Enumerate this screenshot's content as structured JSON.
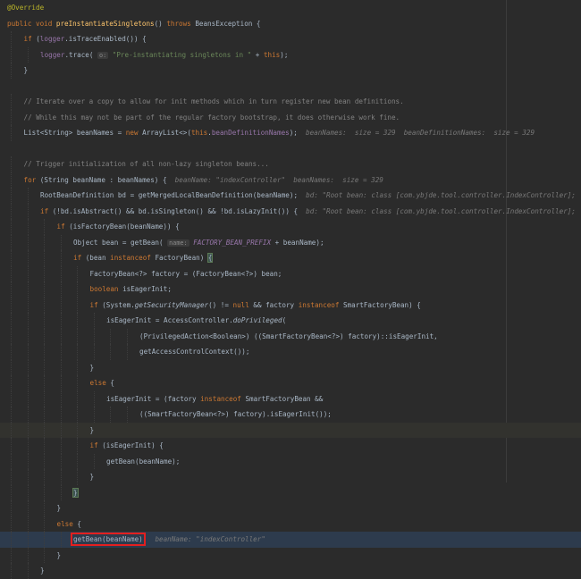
{
  "editor": {
    "lines": [
      {
        "indent": 0,
        "segs": [
          {
            "t": "@Override",
            "c": "ann"
          }
        ]
      },
      {
        "indent": 0,
        "segs": [
          {
            "t": "public void ",
            "c": "kw"
          },
          {
            "t": "preInstantiateSingletons",
            "c": "fn"
          },
          {
            "t": "() "
          },
          {
            "t": "throws ",
            "c": "kw"
          },
          {
            "t": "BeansException {"
          }
        ]
      },
      {
        "indent": 1,
        "segs": [
          {
            "t": "if ",
            "c": "kw"
          },
          {
            "t": "("
          },
          {
            "t": "logger",
            "c": "fld"
          },
          {
            "t": ".isTraceEnabled()) {"
          }
        ]
      },
      {
        "indent": 2,
        "segs": [
          {
            "t": "logger",
            "c": "fld"
          },
          {
            "t": ".trace( "
          },
          {
            "t": "o:",
            "c": "phint"
          },
          {
            "t": " "
          },
          {
            "t": "\"Pre-instantiating singletons in \"",
            "c": "str"
          },
          {
            "t": " + "
          },
          {
            "t": "this",
            "c": "kw"
          },
          {
            "t": ");"
          }
        ]
      },
      {
        "indent": 1,
        "segs": [
          {
            "t": "}"
          }
        ]
      },
      {
        "indent": 0,
        "segs": []
      },
      {
        "indent": 1,
        "segs": [
          {
            "t": "// Iterate over a copy to allow for init methods which in turn register new bean definitions.",
            "c": "cmt"
          }
        ]
      },
      {
        "indent": 1,
        "segs": [
          {
            "t": "// While this may not be part of the regular factory bootstrap, it does otherwise work fine.",
            "c": "cmt"
          }
        ]
      },
      {
        "indent": 1,
        "segs": [
          {
            "t": "List<String> beanNames = "
          },
          {
            "t": "new ",
            "c": "kw"
          },
          {
            "t": "ArrayList<>("
          },
          {
            "t": "this",
            "c": "kw"
          },
          {
            "t": "."
          },
          {
            "t": "beanDefinitionNames",
            "c": "fld"
          },
          {
            "t": ");  "
          },
          {
            "t": "beanNames:  size = 329  beanDefinitionNames:  size = 329",
            "c": "hint"
          }
        ]
      },
      {
        "indent": 0,
        "segs": []
      },
      {
        "indent": 1,
        "segs": [
          {
            "t": "// Trigger initialization of all non-lazy singleton beans...",
            "c": "cmt"
          }
        ]
      },
      {
        "indent": 1,
        "segs": [
          {
            "t": "for ",
            "c": "kw"
          },
          {
            "t": "(String beanName : beanNames) {  "
          },
          {
            "t": "beanName: \"indexController\"  beanNames:  size = 329",
            "c": "hint"
          }
        ]
      },
      {
        "indent": 2,
        "segs": [
          {
            "t": "RootBeanDefinition bd = getMergedLocalBeanDefinition(beanName);  "
          },
          {
            "t": "bd: \"Root bean: class [com.ybjde.tool.controller.IndexController];",
            "c": "hint"
          }
        ]
      },
      {
        "indent": 2,
        "segs": [
          {
            "t": "if ",
            "c": "kw"
          },
          {
            "t": "(!bd.isAbstract() && bd.isSingleton() && !bd.isLazyInit()) {  "
          },
          {
            "t": "bd: \"Root bean: class [com.ybjde.tool.controller.IndexController];",
            "c": "hint"
          }
        ]
      },
      {
        "indent": 3,
        "segs": [
          {
            "t": "if ",
            "c": "kw"
          },
          {
            "t": "(isFactoryBean(beanName)) {"
          }
        ]
      },
      {
        "indent": 4,
        "segs": [
          {
            "t": "Object bean = getBean( "
          },
          {
            "t": "name:",
            "c": "phint"
          },
          {
            "t": " "
          },
          {
            "t": "FACTORY_BEAN_PREFIX",
            "c": "sfld"
          },
          {
            "t": " + beanName);"
          }
        ]
      },
      {
        "indent": 4,
        "segs": [
          {
            "t": "if ",
            "c": "kw"
          },
          {
            "t": "(bean "
          },
          {
            "t": "instanceof ",
            "c": "kw"
          },
          {
            "t": "FactoryBean) "
          },
          {
            "t": "{",
            "c": "brace-match"
          }
        ]
      },
      {
        "indent": 5,
        "segs": [
          {
            "t": "FactoryBean<?> factory = (FactoryBean<?>) bean;"
          }
        ]
      },
      {
        "indent": 5,
        "segs": [
          {
            "t": "boolean ",
            "c": "kw"
          },
          {
            "t": "isEagerInit;"
          }
        ]
      },
      {
        "indent": 5,
        "segs": [
          {
            "t": "if ",
            "c": "kw"
          },
          {
            "t": "(System."
          },
          {
            "t": "getSecurityManager",
            "c": "it"
          },
          {
            "t": "() != "
          },
          {
            "t": "null ",
            "c": "kw"
          },
          {
            "t": "&& factory "
          },
          {
            "t": "instanceof ",
            "c": "kw"
          },
          {
            "t": "SmartFactoryBean) {"
          }
        ]
      },
      {
        "indent": 6,
        "segs": [
          {
            "t": "isEagerInit = AccessController."
          },
          {
            "t": "doPrivileged",
            "c": "it"
          },
          {
            "t": "("
          }
        ]
      },
      {
        "indent": 8,
        "segs": [
          {
            "t": "(PrivilegedAction<Boolean>) ((SmartFactoryBean<?>) factory)::isEagerInit,"
          }
        ]
      },
      {
        "indent": 8,
        "segs": [
          {
            "t": "getAccessControlContext());"
          }
        ]
      },
      {
        "indent": 5,
        "segs": [
          {
            "t": "}"
          }
        ]
      },
      {
        "indent": 5,
        "segs": [
          {
            "t": "else ",
            "c": "kw"
          },
          {
            "t": "{"
          }
        ]
      },
      {
        "indent": 6,
        "segs": [
          {
            "t": "isEagerInit = (factory "
          },
          {
            "t": "instanceof ",
            "c": "kw"
          },
          {
            "t": "SmartFactoryBean &&"
          }
        ]
      },
      {
        "indent": 8,
        "segs": [
          {
            "t": "((SmartFactoryBean<?>) factory).isEagerInit());"
          }
        ]
      },
      {
        "indent": 5,
        "segs": [
          {
            "t": "}"
          }
        ]
      },
      {
        "indent": 5,
        "segs": [
          {
            "t": "if ",
            "c": "kw"
          },
          {
            "t": "(isEagerInit) {"
          }
        ]
      },
      {
        "indent": 6,
        "segs": [
          {
            "t": "getBean(beanName);"
          }
        ]
      },
      {
        "indent": 5,
        "segs": [
          {
            "t": "}"
          }
        ]
      },
      {
        "indent": 4,
        "segs": [
          {
            "t": "}",
            "c": "brace-match"
          }
        ]
      },
      {
        "indent": 3,
        "segs": [
          {
            "t": "}"
          }
        ]
      },
      {
        "indent": 3,
        "segs": [
          {
            "t": "else ",
            "c": "kw"
          },
          {
            "t": "{"
          }
        ]
      },
      {
        "indent": 4,
        "segs": [
          {
            "t": "getBean(beanName)",
            "c": "redbox"
          },
          {
            "t": ";  "
          },
          {
            "t": "beanName: \"indexController\"",
            "c": "hint"
          }
        ]
      },
      {
        "indent": 3,
        "segs": [
          {
            "t": "}"
          }
        ]
      },
      {
        "indent": 2,
        "segs": [
          {
            "t": "}"
          }
        ]
      }
    ]
  }
}
